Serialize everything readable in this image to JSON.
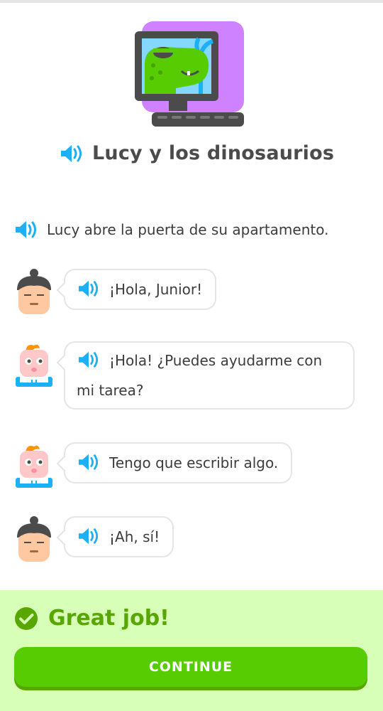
{
  "story": {
    "title": "Lucy y los dinosaurios",
    "narration": "Lucy abre la puerta de su apartamento."
  },
  "dialogue": [
    {
      "speaker": "Lucy",
      "text": "¡Hola, Junior!"
    },
    {
      "speaker": "Junior",
      "text": "¡Hola! ¿Puedes ayudarme con mi tarea?"
    },
    {
      "speaker": "Junior",
      "text": "Tengo que escribir algo."
    },
    {
      "speaker": "Lucy",
      "text": "¡Ah, sí!"
    }
  ],
  "feedback": {
    "title": "Great job!",
    "continue_label": "CONTINUE"
  },
  "icons": {
    "speaker": "speaker-icon",
    "check": "check-circle-icon",
    "story_art": "dinosaur-on-computer-icon"
  },
  "colors": {
    "accent_blue": "#1cb0f6",
    "success_green": "#58cc02",
    "success_dark": "#58a700",
    "feedback_bg": "#d7ffb8"
  }
}
